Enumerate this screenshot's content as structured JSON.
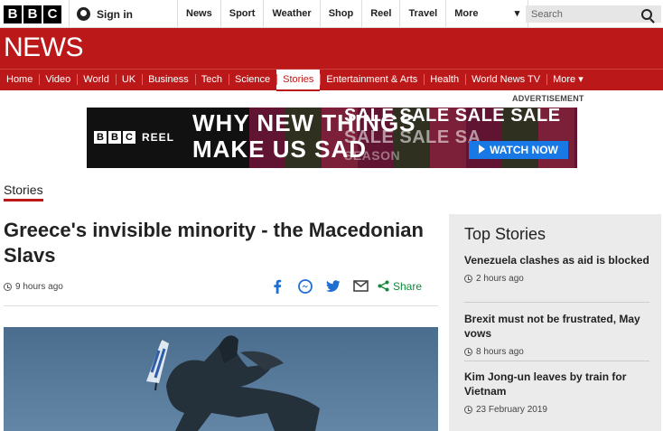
{
  "topbar": {
    "logo_letters": [
      "B",
      "B",
      "C"
    ],
    "signin_label": "Sign in",
    "nav": [
      "News",
      "Sport",
      "Weather",
      "Shop",
      "Reel",
      "Travel"
    ],
    "more_label": "More",
    "search_placeholder": "Search"
  },
  "news_brand": "NEWS",
  "news_nav": [
    {
      "label": "Home",
      "active": false
    },
    {
      "label": "Video",
      "active": false
    },
    {
      "label": "World",
      "active": false
    },
    {
      "label": "UK",
      "active": false
    },
    {
      "label": "Business",
      "active": false
    },
    {
      "label": "Tech",
      "active": false
    },
    {
      "label": "Science",
      "active": false
    },
    {
      "label": "Stories",
      "active": true
    },
    {
      "label": "Entertainment & Arts",
      "active": false
    },
    {
      "label": "Health",
      "active": false
    },
    {
      "label": "World News TV",
      "active": false
    },
    {
      "label": "More ▾",
      "active": false
    }
  ],
  "advert": {
    "label": "ADVERTISEMENT",
    "brand_letters": [
      "B",
      "B",
      "C"
    ],
    "brand_word": "REEL",
    "headline_line1": "WHY NEW THINGS",
    "headline_line2": "MAKE US SAD",
    "sale_row1": "SALE SALE SALE SALE",
    "sale_row2": "SALE SALE SA",
    "sale_row3": "SEASON",
    "cta": "WATCH NOW"
  },
  "section_label": "Stories",
  "article": {
    "title": "Greece's invisible minority - the Macedonian Slavs",
    "time": "9 hours ago",
    "share_label": "Share",
    "share_icons": [
      "facebook-icon",
      "messenger-icon",
      "twitter-icon",
      "email-icon",
      "share-icon"
    ]
  },
  "sidebar": {
    "heading": "Top Stories",
    "stories": [
      {
        "headline": "Venezuela clashes as aid is blocked",
        "time": "2 hours ago"
      },
      {
        "headline": "Brexit must not be frustrated, May vows",
        "time": "8 hours ago"
      },
      {
        "headline": "Kim Jong-un leaves by train for Vietnam",
        "time": "23 February 2019"
      }
    ]
  },
  "colors": {
    "brand_red": "#bb1919",
    "share_green": "#108a3a",
    "share_blue": "#1f6fd1"
  }
}
